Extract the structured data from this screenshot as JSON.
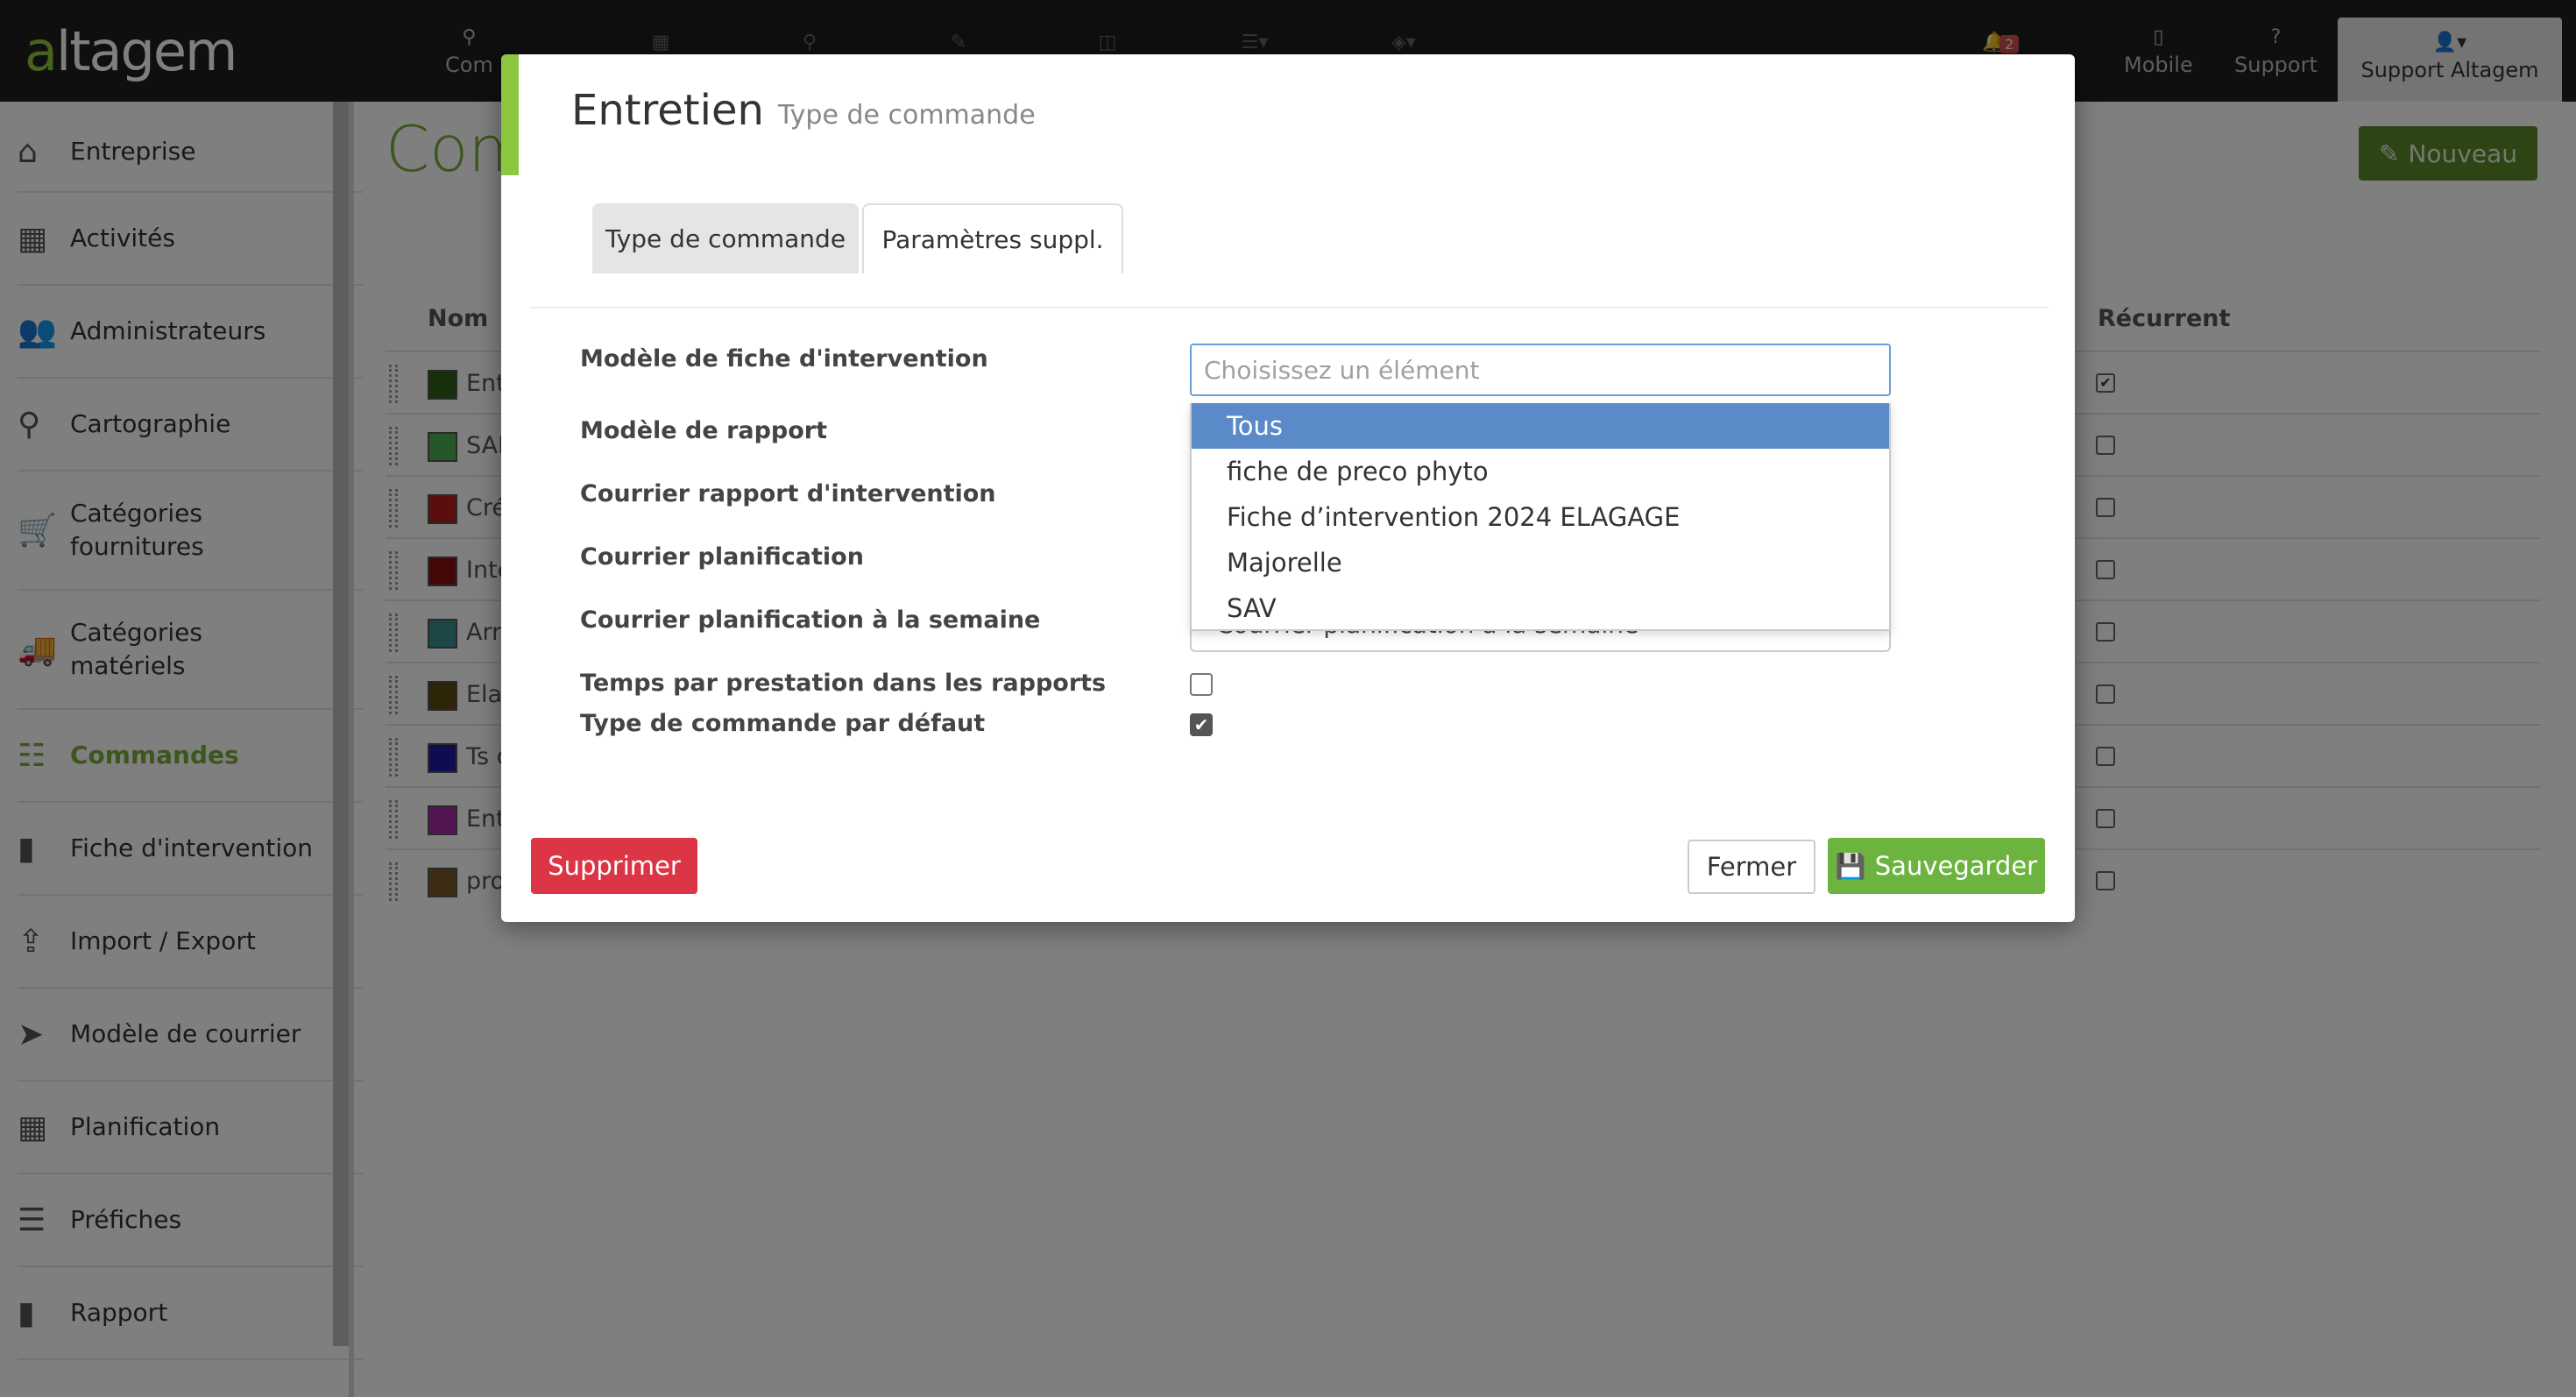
{
  "brand": {
    "logo_text": "altagem"
  },
  "topnav": {
    "truncated_item": "Com",
    "notification_count": "2",
    "mobile_label": "Mobile",
    "support_label": "Support",
    "user_label": "Support Altagem"
  },
  "sidebar": {
    "items": [
      {
        "label": "Entreprise",
        "icon": "home-icon"
      },
      {
        "label": "Activités",
        "icon": "dashboard-icon"
      },
      {
        "label": "Administrateurs",
        "icon": "users-icon"
      },
      {
        "label": "Cartographie",
        "icon": "map-marker-icon"
      },
      {
        "label": "Catégories fournitures",
        "icon": "cart-icon"
      },
      {
        "label": "Catégories matériels",
        "icon": "truck-icon"
      },
      {
        "label": "Commandes",
        "icon": "list-icon",
        "active": true
      },
      {
        "label": "Fiche d'intervention",
        "icon": "file-icon"
      },
      {
        "label": "Import / Export",
        "icon": "upload-icon"
      },
      {
        "label": "Modèle de courrier",
        "icon": "send-icon"
      },
      {
        "label": "Planification",
        "icon": "calendar-icon"
      },
      {
        "label": "Préfiches",
        "icon": "stack-icon"
      },
      {
        "label": "Rapport",
        "icon": "file-icon"
      }
    ]
  },
  "page": {
    "title_partial": "Comn",
    "new_button": "Nouveau",
    "col_name": "Nom",
    "col_recurrent": "Récurrent",
    "rows": [
      {
        "name": "Ent",
        "color": "#2e5e16",
        "recurrent": true
      },
      {
        "name": "SAI",
        "color": "#4caf50",
        "recurrent": false
      },
      {
        "name": "Cré",
        "color": "#b71c1c",
        "recurrent": false
      },
      {
        "name": "Inte",
        "color": "#8b1010",
        "recurrent": false
      },
      {
        "name": "Arr",
        "color": "#3a8f8f",
        "recurrent": false
      },
      {
        "name": "Elag",
        "color": "#5c4a13",
        "recurrent": false
      },
      {
        "name": "Ts d",
        "color": "#1a1aa0",
        "recurrent": false
      },
      {
        "name": "Ent",
        "color": "#a52aa5",
        "recurrent": false
      },
      {
        "name": "pro",
        "color": "#7b5a2a",
        "recurrent": false
      }
    ]
  },
  "modal": {
    "title": "Entretien",
    "subtitle": "Type de commande",
    "tabs": [
      {
        "label": "Type de commande",
        "active": false
      },
      {
        "label": "Paramètres suppl.",
        "active": true
      }
    ],
    "fields": {
      "fiche_label": "Modèle de fiche d'intervention",
      "search_placeholder": "Choisissez un élément",
      "rapport_label": "Modèle de rapport",
      "courrier_rapport_label": "Courrier rapport d'intervention",
      "courrier_planif_label": "Courrier planification",
      "courrier_semaine_label": "Courrier planification à la semaine",
      "courrier_semaine_value": "Courrier planification à la semaine",
      "temps_label": "Temps par prestation dans les rapports",
      "temps_checked": false,
      "defaut_label": "Type de commande par défaut",
      "defaut_checked": true
    },
    "dropdown_options": [
      {
        "label": "Tous",
        "highlighted": true
      },
      {
        "label": "fiche de preco phyto"
      },
      {
        "label": "Fiche d’intervention 2024 ELAGAGE"
      },
      {
        "label": "Majorelle"
      },
      {
        "label": "SAV"
      }
    ],
    "buttons": {
      "delete": "Supprimer",
      "close": "Fermer",
      "save": "Sauvegarder"
    }
  },
  "colors": {
    "accent_green": "#8dc63f",
    "danger_red": "#dc3545",
    "highlight_blue": "#5a8ac8"
  }
}
